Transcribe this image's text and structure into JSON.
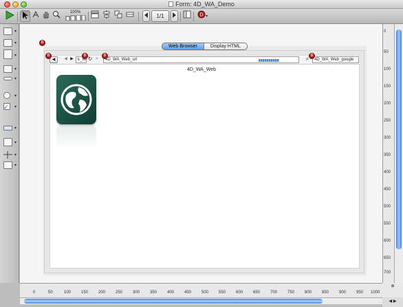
{
  "window": {
    "title": "Form: 4D_WA_Demo"
  },
  "toolbar": {
    "zoom_label": "100%",
    "page_indicator": "1/1"
  },
  "tabs": [
    {
      "label": "Web Browser",
      "active": true
    },
    {
      "label": "Display HTML",
      "active": false
    }
  ],
  "webarea": {
    "name": "4D_WA_Web",
    "url_field_value": "4D_WA_Web_url",
    "search_field_value": "4D_WA_Web_google",
    "wr_field_value": "k_WR"
  },
  "vertical_ruler": [
    "0",
    "50",
    "100",
    "150",
    "200",
    "250",
    "300",
    "350",
    "400",
    "450",
    "500",
    "550",
    "600",
    "650",
    "700"
  ],
  "horizontal_ruler": [
    "0",
    "50",
    "100",
    "150",
    "200",
    "250",
    "300",
    "350",
    "400",
    "450",
    "500",
    "550",
    "600",
    "650",
    "700",
    "750",
    "800",
    "850",
    "900",
    "950",
    "1000"
  ],
  "colors": {
    "accent_blue": "#5d9de6",
    "logo_green": "#1f5a4b",
    "marker_red": "#b41e1e"
  }
}
